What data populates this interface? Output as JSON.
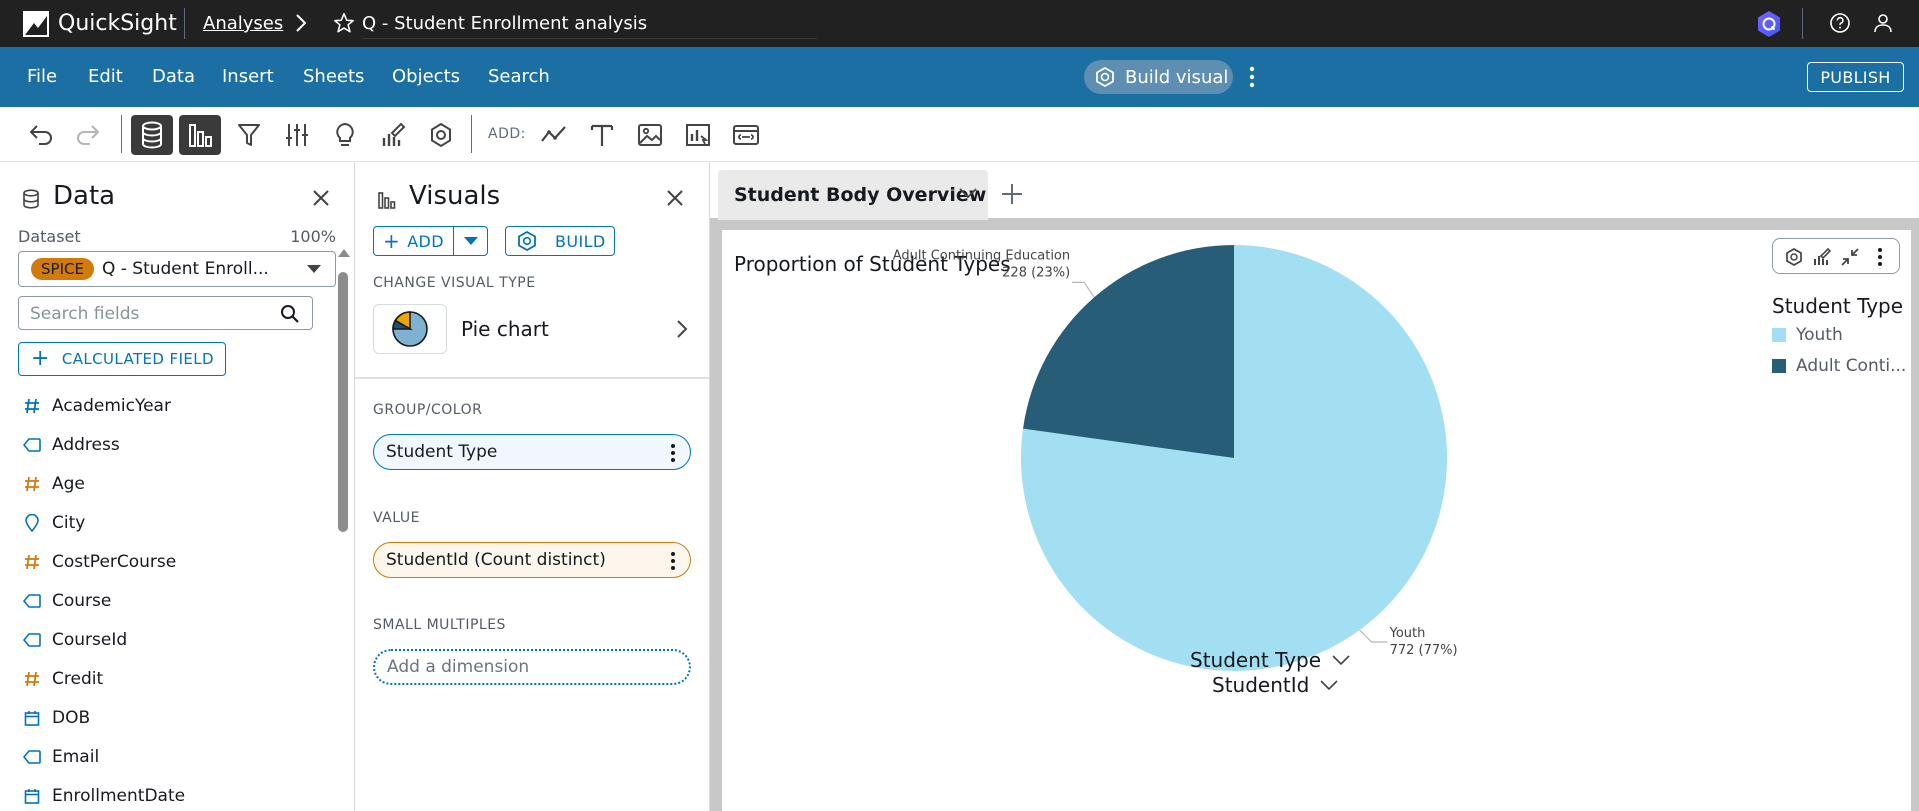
{
  "topbar": {
    "brand": "QuickSight",
    "breadcrumb": "Analyses",
    "analysis_title": "Q - Student Enrollment analysis"
  },
  "menubar": {
    "items": [
      "File",
      "Edit",
      "Data",
      "Insert",
      "Sheets",
      "Objects",
      "Search"
    ],
    "build_visual": "Build visual",
    "publish": "PUBLISH"
  },
  "toolbar": {
    "add_label": "ADD:"
  },
  "data_pane": {
    "title": "Data",
    "dataset_label": "Dataset",
    "dataset_pct": "100%",
    "spice": "SPICE",
    "dataset_name": "Q - Student Enroll...",
    "search_placeholder": "Search fields",
    "calc_field": "CALCULATED FIELD",
    "fields": [
      {
        "name": "AcademicYear",
        "type": "number"
      },
      {
        "name": "Address",
        "type": "string"
      },
      {
        "name": "Age",
        "type": "number-orange"
      },
      {
        "name": "City",
        "type": "geo"
      },
      {
        "name": "CostPerCourse",
        "type": "number-orange"
      },
      {
        "name": "Course",
        "type": "string"
      },
      {
        "name": "CourseId",
        "type": "string"
      },
      {
        "name": "Credit",
        "type": "number-orange"
      },
      {
        "name": "DOB",
        "type": "date"
      },
      {
        "name": "Email",
        "type": "string"
      },
      {
        "name": "EnrollmentDate",
        "type": "date"
      }
    ]
  },
  "visuals_pane": {
    "title": "Visuals",
    "add": "ADD",
    "build": "BUILD",
    "change_visual_type": "CHANGE VISUAL TYPE",
    "visual_type": "Pie chart",
    "group_color_label": "GROUP/COLOR",
    "group_color_value": "Student Type",
    "value_label": "VALUE",
    "value_value": "StudentId (Count distinct)",
    "small_multiples_label": "SMALL MULTIPLES",
    "small_multiples_placeholder": "Add a dimension"
  },
  "sheet": {
    "tab_name": "Student Body Overview"
  },
  "visual": {
    "title": "Proportion of Student Types",
    "legend_title": "Student Type",
    "legend_items": [
      "Youth",
      "Adult Conti..."
    ],
    "group_by_label": "Student Type",
    "value_label": "StudentId",
    "colors": {
      "youth": "#a3dff2",
      "adult": "#285d78"
    }
  },
  "chart_data": {
    "type": "pie",
    "title": "Proportion of Student Types",
    "categories": [
      "Youth",
      "Adult Continuing Education"
    ],
    "values": [
      772,
      228
    ],
    "percentages": [
      "77%",
      "23%"
    ],
    "data_labels": [
      {
        "category": "Adult Continuing Education",
        "value_text": "228 (23%)"
      },
      {
        "category": "Youth",
        "value_text": "772 (77%)"
      }
    ],
    "legend_title": "Student Type",
    "legend_placement": "right"
  }
}
